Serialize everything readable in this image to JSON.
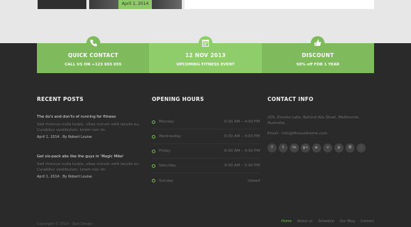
{
  "top_strip": {
    "date_chip": "April 1, 2014"
  },
  "banner": [
    {
      "title": "QUICK CONTACT",
      "subtitle": "CALL US ON +123 655 655",
      "icon": "phone-icon"
    },
    {
      "title": "12 NOV 2013",
      "subtitle": "UPCOMING FITNESS EVENT",
      "icon": "calendar-icon"
    },
    {
      "title": "DISCOUNT",
      "subtitle": "50% off FOR 1 YEAR",
      "icon": "thumbs-up-icon"
    }
  ],
  "recent_posts": {
    "heading": "RECENT POSTS",
    "posts": [
      {
        "title": "The do's and don'ts of running for fitness",
        "excerpt": "Sed rhoncus nulla turpis, vitae rutrum velit iaculis eu. Curabitur vestibulum, lorem non im",
        "meta": "April 1, 2014 . By Robert Louise"
      },
      {
        "title": "Get six-pack abs like the guys in 'Magic Mike'",
        "excerpt": "Sed rhoncus nulla turpis, vitae rutrum velit iaculis eu. Curabitur vestibulum, lorem non im",
        "meta": "April 1, 2014 . By Robert Louise"
      }
    ]
  },
  "opening_hours": {
    "heading": "OPENING HOURS",
    "rows": [
      {
        "day": "Monday",
        "time": "6:00 AM – 4:00 PM"
      },
      {
        "day": "Wednesday",
        "time": "6:00 AM – 4:00 PM"
      },
      {
        "day": "Friday",
        "time": "6:00 AM – 4:00 PM"
      },
      {
        "day": "Saturday",
        "time": "9:00 AM – 5:00 PM"
      },
      {
        "day": "Sunday",
        "time": "closed"
      }
    ]
  },
  "contact_info": {
    "heading": "CONTACT INFO",
    "address": "205, Envato Labs, Behind Alis Steet, Melbourne, Australia.",
    "email": "Email : info@fitnesstheme.com",
    "socials": [
      {
        "icon": "facebook-icon",
        "glyph": "f"
      },
      {
        "icon": "twitter-icon",
        "glyph": "t"
      },
      {
        "icon": "linkedin-icon",
        "glyph": "in"
      },
      {
        "icon": "google-plus-icon",
        "glyph": "g+"
      },
      {
        "icon": "youtube-icon",
        "glyph": "▶"
      },
      {
        "icon": "vimeo-icon",
        "glyph": "v"
      },
      {
        "icon": "pinterest-icon",
        "glyph": "p"
      },
      {
        "icon": "instagram-icon",
        "glyph": "◘"
      },
      {
        "icon": "rss-icon",
        "glyph": "◌"
      }
    ]
  },
  "footer": {
    "copyright": "Copyright © 2014 - Skat Design",
    "nav": [
      "Home",
      "About us",
      "Schedule",
      "Our Blog",
      "Contact"
    ],
    "active": "Home"
  },
  "colors": {
    "accent": "#7fba5c",
    "accent_light": "#8fcc6a",
    "background": "#2a2a2a"
  }
}
